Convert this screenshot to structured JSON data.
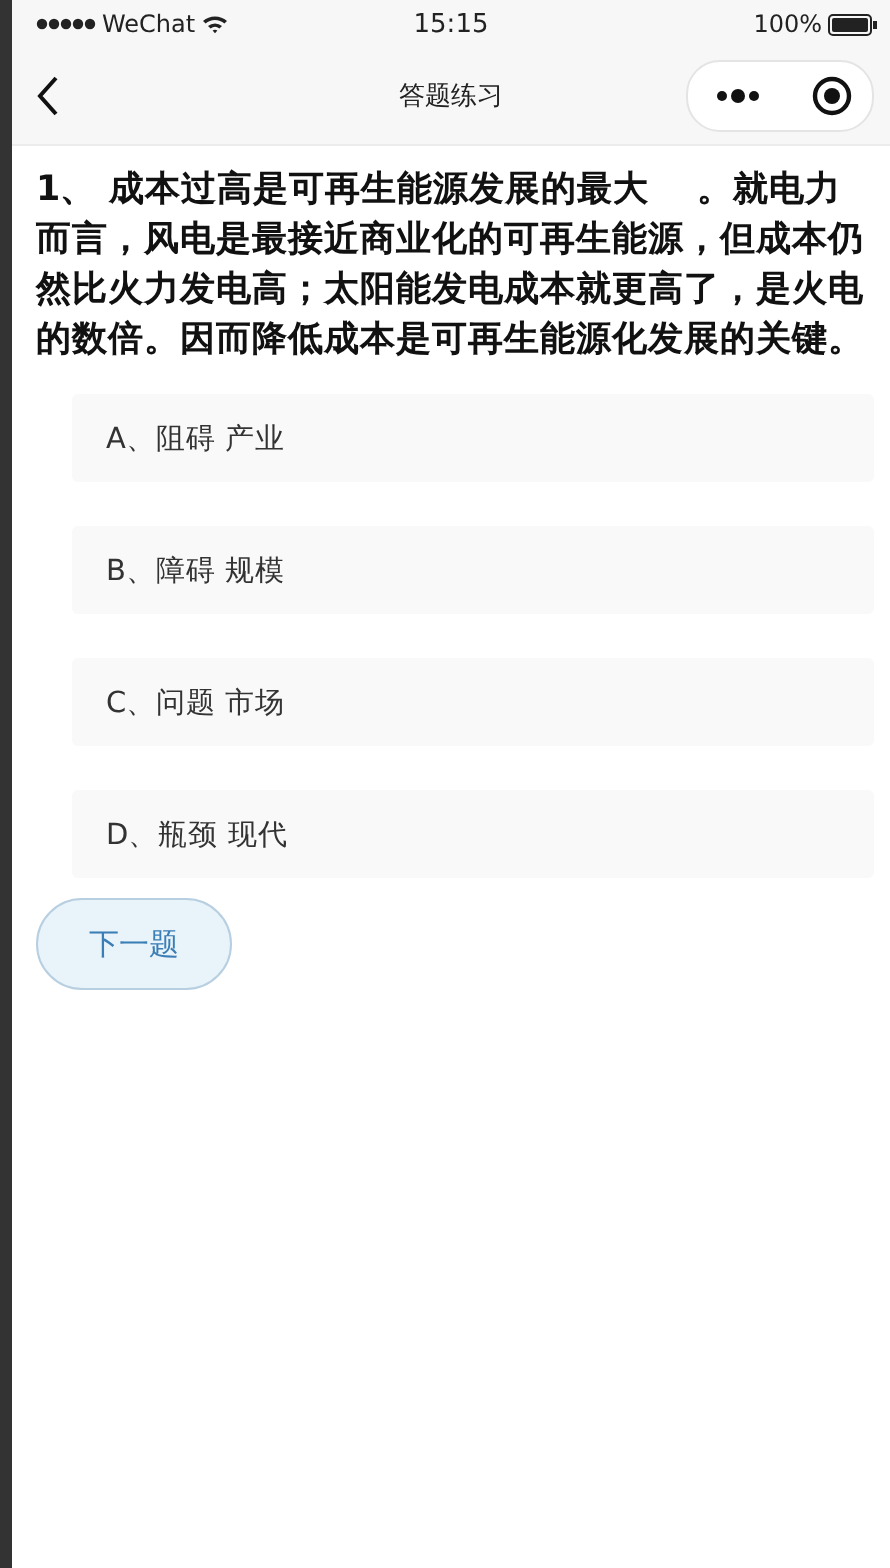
{
  "status_bar": {
    "carrier": "WeChat",
    "time": "15:15",
    "battery": "100%"
  },
  "nav_bar": {
    "title": "答题练习"
  },
  "question": {
    "text": "1、 成本过高是可再生能源发展的最大　 。就电力而言，风电是最接近商业化的可再生能源，但成本仍然比火力发电高；太阳能发电成本就更高了，是火电的数倍。因而降低成本是可再生能源化发展的关键。"
  },
  "options": [
    {
      "label": "A、阻碍 产业",
      "selected": false
    },
    {
      "label": "B、障碍 规模",
      "selected": false
    },
    {
      "label": "C、问题 市场",
      "selected": false
    },
    {
      "label": "D、瓶颈 现代",
      "selected": false
    }
  ],
  "next_button": {
    "label": "下一题"
  }
}
